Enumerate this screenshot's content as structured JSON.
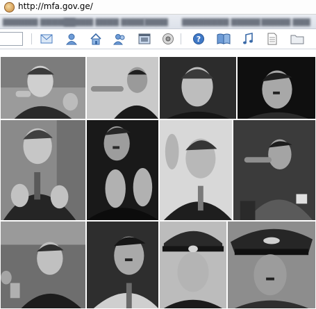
{
  "browser": {
    "url": "http://mfa.gov.ge/"
  },
  "toolbar": {
    "icons": [
      "mail-icon",
      "user-icon",
      "home-icon",
      "users-icon",
      "window-icon",
      "media-icon",
      "help-icon",
      "book-icon",
      "music-icon",
      "document-icon",
      "folder-icon"
    ]
  },
  "colors": {
    "toolbar_icon": "#4a7cc0",
    "photo_dark": "#1d1d1d",
    "photo_mid": "#6b6b6b",
    "photo_light": "#bdbdbd"
  }
}
